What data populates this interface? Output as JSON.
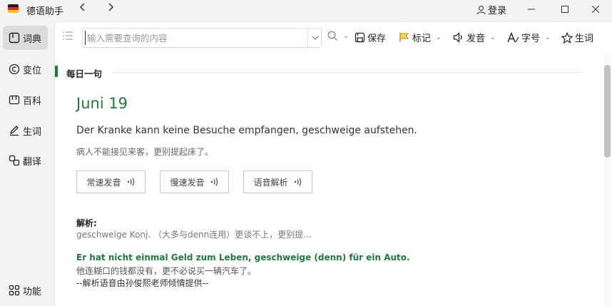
{
  "app": {
    "title": "德语助手"
  },
  "titlebar": {
    "login_label": "登录"
  },
  "sidebar": {
    "items": [
      {
        "label": "词典",
        "icon": "dictionary-icon"
      },
      {
        "label": "变位",
        "icon": "conjugation-icon"
      },
      {
        "label": "百科",
        "icon": "encyclopedia-icon"
      },
      {
        "label": "生词",
        "icon": "vocabulary-icon"
      },
      {
        "label": "翻译",
        "icon": "translate-icon"
      }
    ],
    "function_label": "功能"
  },
  "toolbar": {
    "search_placeholder": "输入需要查询的内容",
    "save_label": "保存",
    "mark_label": "标记",
    "pronounce_label": "发音",
    "fontsize_label": "字号",
    "vocab_label": "生词"
  },
  "daily": {
    "section_title": "每日一句",
    "date": "Juni 19",
    "sentence": "Der Kranke kann keine Besuche empfangen, geschweige aufstehen.",
    "translation": "病人不能接见来客，更别提起床了。",
    "buttons": [
      "常速发音",
      "慢速发音",
      "语音解析"
    ],
    "analysis_label": "解析:",
    "analysis_text": "geschweige Konj. （大多与denn连用）更谈不上，更别提...",
    "example_de": "Er hat nicht einmal Geld zum Leben, geschweige (denn) für ein Auto.",
    "example_zh": "他连糊口的钱都没有，更不必说买一辆汽车了。",
    "credit": "--解析语音由孙俊熙老师倾情提供--"
  },
  "colors": {
    "accent": "#1e7a3c",
    "active_bg": "#dcdcdc"
  }
}
